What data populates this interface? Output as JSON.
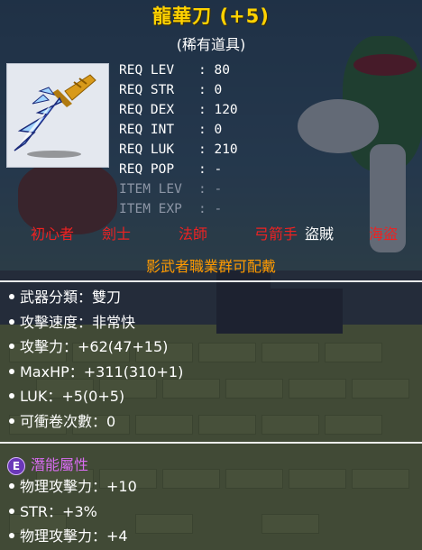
{
  "item": {
    "name": "龍華刀 (+5)",
    "rarity": "(稀有道具)"
  },
  "requirements": [
    {
      "label": "REQ LEV",
      "value": ": 80",
      "active": true
    },
    {
      "label": "REQ STR",
      "value": ": 0",
      "active": true
    },
    {
      "label": "REQ DEX",
      "value": ": 120",
      "active": true
    },
    {
      "label": "REQ INT",
      "value": ": 0",
      "active": true
    },
    {
      "label": "REQ LUK",
      "value": ": 210",
      "active": true
    },
    {
      "label": "REQ POP",
      "value": ": -",
      "active": true
    },
    {
      "label": "ITEM LEV",
      "value": ": -",
      "active": false
    },
    {
      "label": "ITEM EXP",
      "value": ": -",
      "active": false
    }
  ],
  "jobs": [
    {
      "label": "初心者",
      "allowed": false
    },
    {
      "label": "劍士",
      "allowed": false
    },
    {
      "label": "法師",
      "allowed": false
    },
    {
      "label": "弓箭手",
      "allowed": false
    },
    {
      "label": "盜賊",
      "allowed": true
    },
    {
      "label": "海盜",
      "allowed": false
    }
  ],
  "job_note": "影武者職業群可配戴",
  "stats": [
    "武器分類：雙刀",
    "攻擊速度：非常快",
    "攻擊力：+62(47+15)",
    "MaxHP：+311(310+1)",
    "LUK：+5(0+5)",
    "可衝卷次數：0"
  ],
  "potential": {
    "badge": "E",
    "title": "潛能屬性",
    "lines": [
      "物理攻擊力：+10",
      "STR：+3%",
      "物理攻擊力：+4"
    ]
  },
  "colors": {
    "title": "#ffd200",
    "forbidden_job": "#ee2222",
    "allowed_job": "#ffffff",
    "note": "#ff9a00",
    "potential": "#d86cf0"
  },
  "icons": {
    "item": "dual-blade-knife-icon",
    "potential_grade": "potential-grade-badge"
  }
}
